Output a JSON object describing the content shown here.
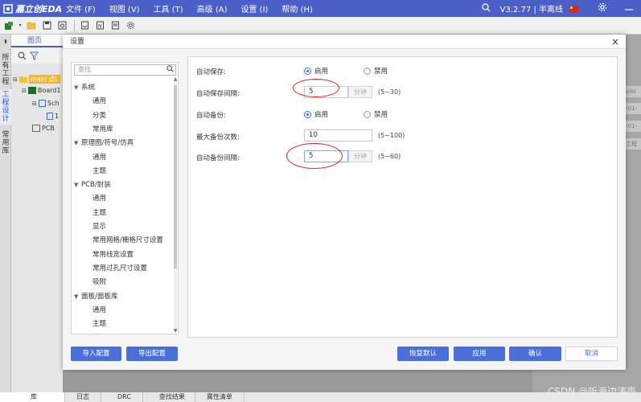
{
  "app": {
    "logo_text": "嘉立创EDA",
    "menus": [
      "文件 (F)",
      "视图 (V)",
      "工具 (T)",
      "高级 (A)",
      "设置 (I)",
      "帮助 (H)"
    ],
    "version": "V3.2.77 | 半离线"
  },
  "left_rail": {
    "tabs": [
      "所有工程",
      "工程设计",
      "常用库"
    ]
  },
  "left_panel": {
    "header": "图页",
    "tree": [
      "main 点L",
      "Board1",
      "Sch",
      "1",
      "PCB"
    ]
  },
  "right_bg": {
    "cells": [
      "aibi",
      "-01-",
      "-01-",
      "工程"
    ]
  },
  "dialog": {
    "title": "设置",
    "close": "×",
    "search_placeholder": "查找",
    "tree": [
      {
        "label": "系统",
        "level": 0
      },
      {
        "label": "通用",
        "level": 1
      },
      {
        "label": "分类",
        "level": 1
      },
      {
        "label": "常用库",
        "level": 1
      },
      {
        "label": "原理图/符号/仿真",
        "level": 0
      },
      {
        "label": "通用",
        "level": 1
      },
      {
        "label": "主题",
        "level": 1
      },
      {
        "label": "PCB/封装",
        "level": 0
      },
      {
        "label": "通用",
        "level": 1
      },
      {
        "label": "主题",
        "level": 1
      },
      {
        "label": "显示",
        "level": 1
      },
      {
        "label": "常用网格/栅格尺寸设置",
        "level": 1
      },
      {
        "label": "常用线宽设置",
        "level": 1
      },
      {
        "label": "常用过孔尺寸设置",
        "level": 1
      },
      {
        "label": "吸附",
        "level": 1
      },
      {
        "label": "面板/面板库",
        "level": 0
      },
      {
        "label": "通用",
        "level": 1
      },
      {
        "label": "主题",
        "level": 1
      },
      {
        "label": "常用库",
        "level": 1
      }
    ],
    "settings": {
      "auto_save_label": "自动保存:",
      "auto_save_enable": "启用",
      "auto_save_disable": "禁用",
      "auto_save_interval_label": "自动保存间隔:",
      "auto_save_interval_value": "5",
      "auto_save_interval_unit": "分钟",
      "auto_save_interval_range": "(5~30)",
      "auto_backup_label": "自动备份:",
      "auto_backup_enable": "启用",
      "auto_backup_disable": "禁用",
      "max_backup_label": "最大备份次数:",
      "max_backup_value": "10",
      "max_backup_range": "(5~100)",
      "auto_backup_interval_label": "自动备份间隔:",
      "auto_backup_interval_value": "5",
      "auto_backup_interval_unit": "分钟",
      "auto_backup_interval_range": "(5~60)"
    },
    "buttons": {
      "import": "导入配置",
      "export": "导出配置",
      "restore": "恢复默认",
      "apply": "应用",
      "ok": "确认",
      "cancel": "取消"
    }
  },
  "bottom_tabs": [
    "库",
    "日志",
    "DRC",
    "查找结果",
    "属性清单"
  ],
  "watermark": "CSDN @听海边涛声"
}
